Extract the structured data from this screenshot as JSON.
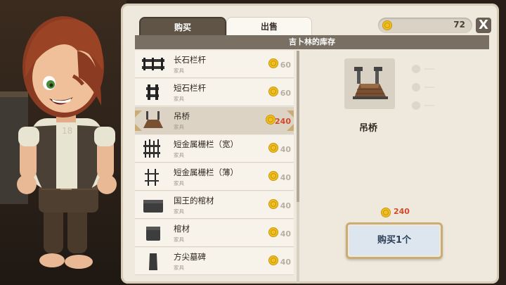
{
  "tabs": {
    "buy": "购买",
    "sell": "出售"
  },
  "coins": {
    "count": "72"
  },
  "close_label": "X",
  "inventory": {
    "title": "吉卜林的库存",
    "items": [
      {
        "name": "长石栏杆",
        "category": "家具",
        "price": "60",
        "icon": "stone-fence-long-icon"
      },
      {
        "name": "短石栏杆",
        "category": "家具",
        "price": "60",
        "icon": "stone-fence-short-icon"
      },
      {
        "name": "吊桥",
        "category": "家具",
        "price": "240",
        "icon": "drawbridge-icon",
        "selected": true
      },
      {
        "name": "短金属栅栏（宽）",
        "category": "家具",
        "price": "40",
        "icon": "metal-fence-wide-icon"
      },
      {
        "name": "短金属栅栏（薄）",
        "category": "家具",
        "price": "40",
        "icon": "metal-fence-thin-icon"
      },
      {
        "name": "国王的棺材",
        "category": "家具",
        "price": "40",
        "icon": "king-coffin-icon"
      },
      {
        "name": "棺材",
        "category": "家具",
        "price": "40",
        "icon": "coffin-icon"
      },
      {
        "name": "方尖墓碑",
        "category": "家具",
        "price": "40",
        "icon": "obelisk-tombstone-icon"
      }
    ]
  },
  "detail": {
    "name": "吊桥",
    "price": "240",
    "buy_label": "购买1个",
    "stats": [
      "--",
      "--",
      "--"
    ]
  },
  "colors": {
    "accent_price": "#d14a2b",
    "panel": "#efe9dd",
    "tab_active": "#5f5446",
    "coin": "#f0c020"
  }
}
